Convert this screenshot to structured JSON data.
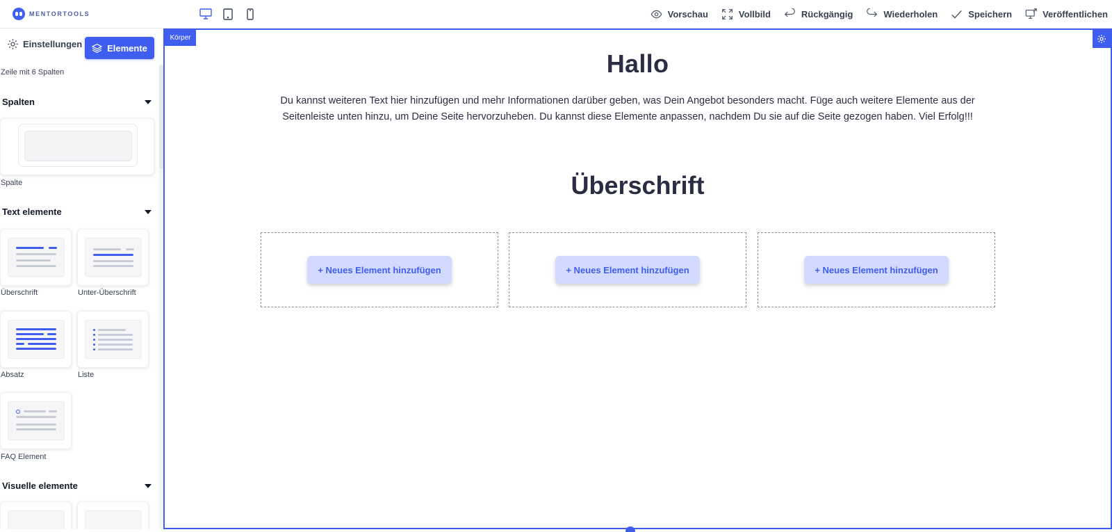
{
  "brand": {
    "name": "MENTORTOOLS"
  },
  "devices": [
    "desktop-icon",
    "tablet-icon",
    "mobile-icon"
  ],
  "toolbar": {
    "preview": "Vorschau",
    "fullscreen": "Vollbild",
    "undo": "Rückgängig",
    "redo": "Wiederholen",
    "save": "Speichern",
    "publish": "Veröffentlichen"
  },
  "sidebar": {
    "tab_settings": "Einstellungen",
    "tab_elements": "Elemente",
    "row_label": "Zeile mit 6 Spalten",
    "sections": {
      "columns": {
        "title": "Spalten",
        "items": [
          "Spalte"
        ]
      },
      "text": {
        "title": "Text elemente",
        "items": [
          "Überschrift",
          "Unter-Überschrift",
          "Absatz",
          "Liste",
          "FAQ Element"
        ]
      },
      "visual": {
        "title": "Visuelle elemente"
      }
    }
  },
  "canvas": {
    "body_tag": "Körper",
    "heading": "Hallo",
    "intro": "Du kannst weiteren Text hier hinzufügen und mehr Informationen darüber geben, was Dein Angebot besonders macht. Füge auch weitere Elemente aus der Seitenleiste unten hinzu, um Deine Seite hervorzuheben. Du kannst diese Elemente anpassen, nachdem Du sie auf die Seite gezogen haben. Viel Erfolg!!!",
    "subheading": "Überschrift",
    "add_element": "+ Neues Element hinzufügen"
  },
  "colors": {
    "accent": "#3f5ef0",
    "button_bg": "#d3daff",
    "text_dark": "#2b2d42"
  }
}
